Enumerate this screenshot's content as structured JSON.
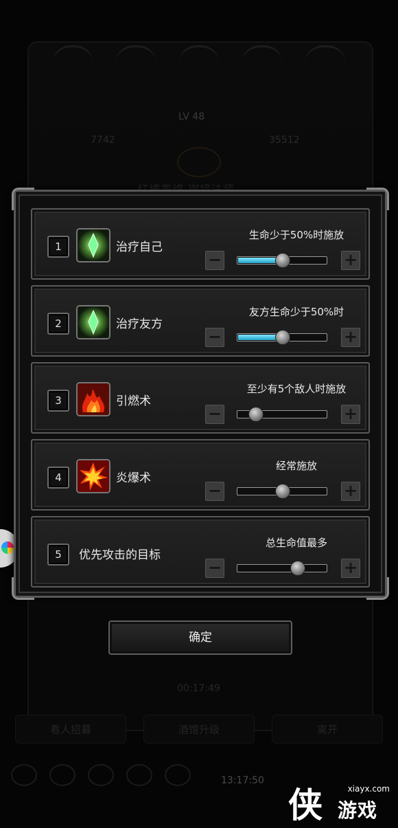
{
  "background": {
    "level_text": "LV 48",
    "stat_left": "7742",
    "stat_right": "35512",
    "title_text": "红棒毒络 岸将法师",
    "timer": "00:17:49",
    "buttons": [
      "看人招募",
      "酒馆升级",
      "离开"
    ],
    "clock": "13:17:50"
  },
  "dialog": {
    "rows": [
      {
        "index": "1",
        "icon": "green-crystal-icon",
        "skill": "治疗自己",
        "condition": "生命少于50%时施放",
        "level": 0.5
      },
      {
        "index": "2",
        "icon": "green-crystal-icon",
        "skill": "治疗友方",
        "condition": "友方生命少于50%时",
        "level": 0.5
      },
      {
        "index": "3",
        "icon": "fire-icon",
        "skill": "引燃术",
        "condition": "至少有5个敌人时施放",
        "level": 0.2
      },
      {
        "index": "4",
        "icon": "explosion-icon",
        "skill": "炎爆术",
        "condition": "经常施放",
        "level": 0.5
      },
      {
        "index": "5",
        "icon": "",
        "skill": "优先攻击的目标",
        "condition": "总生命值最多",
        "level": 0.67
      }
    ],
    "minus_label": "−",
    "plus_label": "+",
    "confirm_label": "确定"
  },
  "watermark": {
    "url": "xiayx.com",
    "glyph": "侠",
    "text": "游戏"
  },
  "colors": {
    "slider_fill": "#3fc6e6",
    "frame": "#5a5a5a",
    "background": "#050505"
  }
}
